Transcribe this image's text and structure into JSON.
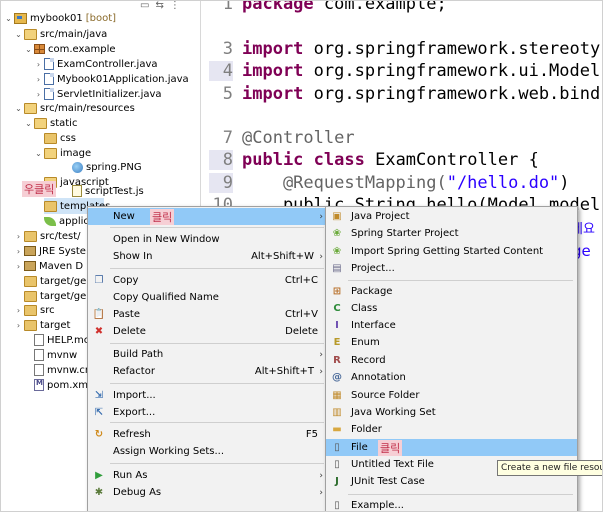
{
  "tree": {
    "project": "mybook01",
    "project_suffix": "[boot]",
    "src_main_java": "src/main/java",
    "package": "com.example",
    "files": [
      "ExamController.java",
      "Mybook01Application.java",
      "ServletInitializer.java"
    ],
    "src_main_resources": "src/main/resources",
    "static": "static",
    "css": "css",
    "image": "image",
    "spring_png": "spring.PNG",
    "javascript": "javascript",
    "scripttest": "scriptTest.js",
    "templates": "templates",
    "applic": "applic",
    "src_test": "src/test/",
    "jre": "JRE Syste",
    "maven": "Maven D",
    "target_ge1": "target/ge",
    "target_ge2": "target/ge",
    "src": "src",
    "target": "target",
    "help": "HELP.mc",
    "mvnw": "mvnw",
    "mvnw_cmd": "mvnw.cr",
    "pom": "pom.xm",
    "korean_label": "우클릭"
  },
  "editor": {
    "lines": [
      {
        "num": "1",
        "parts": [
          {
            "t": "package",
            "c": "kw"
          },
          {
            "t": " com.example;",
            "c": ""
          }
        ]
      },
      {
        "num": "3",
        "parts": [
          {
            "t": "import",
            "c": "kw"
          },
          {
            "t": " org.springframework.stereoty",
            "c": ""
          }
        ]
      },
      {
        "num": "4",
        "parts": [
          {
            "t": "import",
            "c": "kw"
          },
          {
            "t": " org.springframework.ui.Model",
            "c": ""
          }
        ]
      },
      {
        "num": "5",
        "parts": [
          {
            "t": "import",
            "c": "kw"
          },
          {
            "t": " org.springframework.web.bind",
            "c": ""
          }
        ]
      },
      {
        "num": "7",
        "parts": [
          {
            "t": "@Controller",
            "c": "ann"
          }
        ]
      },
      {
        "num": "8",
        "parts": [
          {
            "t": "public",
            "c": "kw"
          },
          {
            "t": " ",
            "c": ""
          },
          {
            "t": "class",
            "c": "kw"
          },
          {
            "t": " ExamController {",
            "c": ""
          }
        ]
      },
      {
        "num": "9",
        "parts": [
          {
            "t": "    @RequestMapping(",
            "c": "ann"
          },
          {
            "t": "\"/hello.do\"",
            "c": "str"
          },
          {
            "t": ")",
            "c": ""
          }
        ]
      },
      {
        "num": "10",
        "parts": [
          {
            "t": "    public String hello(Model model",
            "c": ""
          }
        ]
      }
    ],
    "tail1": "세요",
    "tail2": "ge"
  },
  "menu_main": {
    "items": [
      {
        "label": "New",
        "korean": "클릭",
        "arrow": "›",
        "icon": "",
        "shortcut": ""
      },
      {
        "label": "Open in New Window",
        "icon": "",
        "shortcut": ""
      },
      {
        "label": "Show In",
        "shortcut": "Alt+Shift+W",
        "arrow": "›",
        "icon": ""
      },
      {
        "label": "Copy",
        "shortcut": "Ctrl+C",
        "icon": "copy-icon"
      },
      {
        "label": "Copy Qualified Name",
        "shortcut": "",
        "icon": ""
      },
      {
        "label": "Paste",
        "shortcut": "Ctrl+V",
        "icon": "paste-icon"
      },
      {
        "label": "Delete",
        "shortcut": "Delete",
        "icon": "delete-icon"
      },
      {
        "label": "Build Path",
        "arrow": "›",
        "icon": "",
        "shortcut": ""
      },
      {
        "label": "Refactor",
        "shortcut": "Alt+Shift+T",
        "arrow": "›",
        "icon": ""
      },
      {
        "label": "Import...",
        "icon": "import-icon",
        "shortcut": ""
      },
      {
        "label": "Export...",
        "icon": "export-icon",
        "shortcut": ""
      },
      {
        "label": "Refresh",
        "shortcut": "F5",
        "icon": "refresh-icon"
      },
      {
        "label": "Assign Working Sets...",
        "icon": "",
        "shortcut": ""
      },
      {
        "label": "Run As",
        "arrow": "›",
        "icon": "run-icon",
        "shortcut": ""
      },
      {
        "label": "Debug As",
        "arrow": "›",
        "icon": "debug-icon",
        "shortcut": ""
      }
    ]
  },
  "menu_new": {
    "items": [
      {
        "label": "Java Project",
        "icon": "java-project-icon"
      },
      {
        "label": "Spring Starter Project",
        "icon": "spring-icon"
      },
      {
        "label": "Import Spring Getting Started Content",
        "icon": "spring-import-icon"
      },
      {
        "label": "Project...",
        "icon": "project-icon"
      },
      {
        "label": "Package",
        "icon": "package-icon"
      },
      {
        "label": "Class",
        "icon": "class-icon"
      },
      {
        "label": "Interface",
        "icon": "interface-icon"
      },
      {
        "label": "Enum",
        "icon": "enum-icon"
      },
      {
        "label": "Record",
        "icon": "record-icon"
      },
      {
        "label": "Annotation",
        "icon": "annotation-icon"
      },
      {
        "label": "Source Folder",
        "icon": "source-folder-icon"
      },
      {
        "label": "Java Working Set",
        "icon": "working-set-icon"
      },
      {
        "label": "Folder",
        "icon": "folder-icon"
      },
      {
        "label": "File",
        "korean": "클릭",
        "icon": "file-icon"
      },
      {
        "label": "Untitled Text File",
        "icon": "text-file-icon"
      },
      {
        "label": "JUnit Test Case",
        "icon": "junit-icon"
      },
      {
        "label": "Example...",
        "icon": "example-icon"
      }
    ]
  },
  "tooltip": "Create a new file resou",
  "colors": {
    "keyword": "#7f0055",
    "string": "#2a00ff",
    "annotation": "#646464",
    "highlight": "#91c9f7",
    "korean_tag": "#f6cfd5"
  }
}
